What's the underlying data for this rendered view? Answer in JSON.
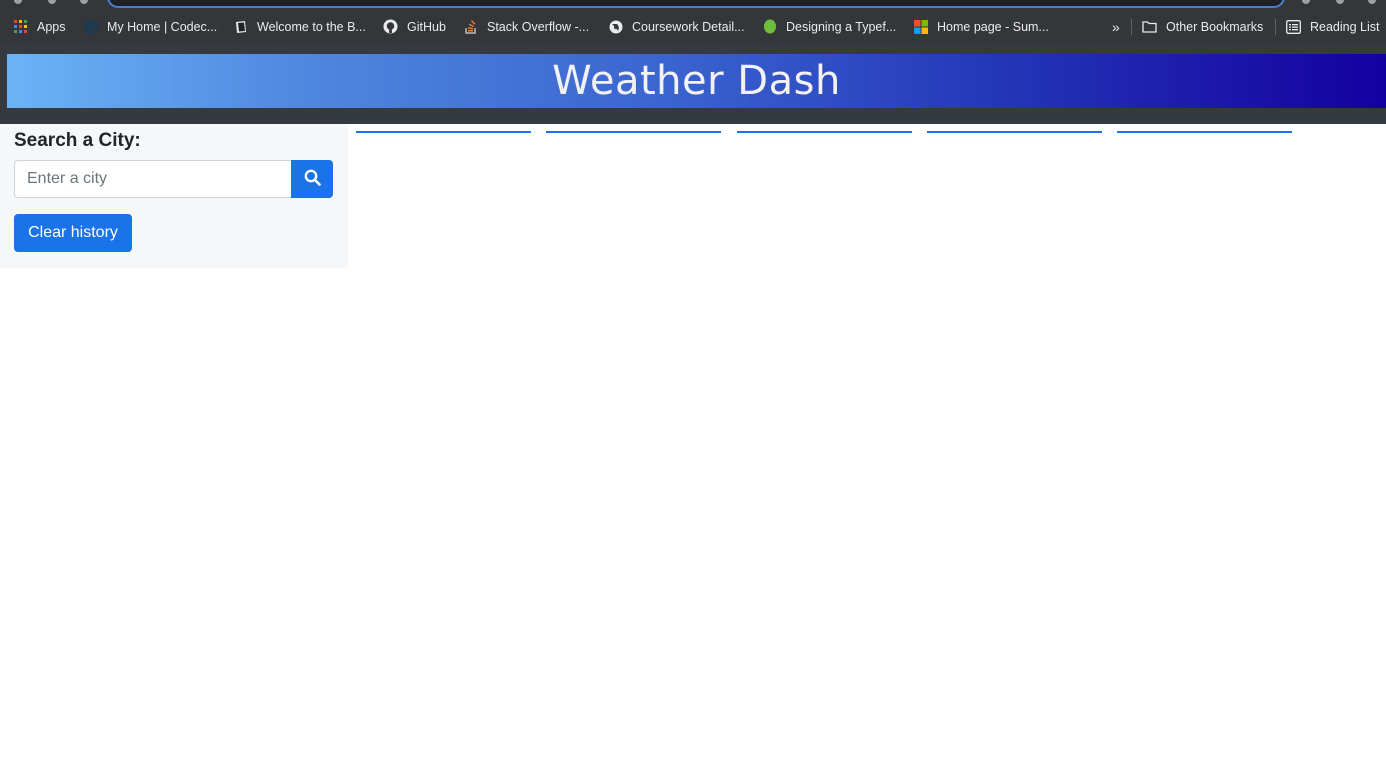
{
  "bookmarks": [
    {
      "label": "Apps",
      "icon": "apps-grid-icon"
    },
    {
      "label": "My Home | Codec...",
      "icon": "codecademy-icon"
    },
    {
      "label": "Welcome to the B...",
      "icon": "book-icon"
    },
    {
      "label": "GitHub",
      "icon": "github-icon"
    },
    {
      "label": "Stack Overflow -...",
      "icon": "stackoverflow-icon"
    },
    {
      "label": "Coursework Detail...",
      "icon": "globe-icon"
    },
    {
      "label": "Designing a Typef...",
      "icon": "leaf-icon"
    },
    {
      "label": "Home page - Sum...",
      "icon": "microsoft-icon"
    }
  ],
  "bookmarks_overflow": "»",
  "other_bookmarks": "Other Bookmarks",
  "reading_list": "Reading List",
  "header": {
    "title": "Weather Dash"
  },
  "sidebar": {
    "heading": "Search a City:",
    "search_placeholder": "Enter a city",
    "clear_label": "Clear history"
  },
  "colors": {
    "primary": "#1a73e8",
    "header_bg": "#343a40",
    "banner_start": "#6ab4f5",
    "banner_end": "#1400a0"
  }
}
